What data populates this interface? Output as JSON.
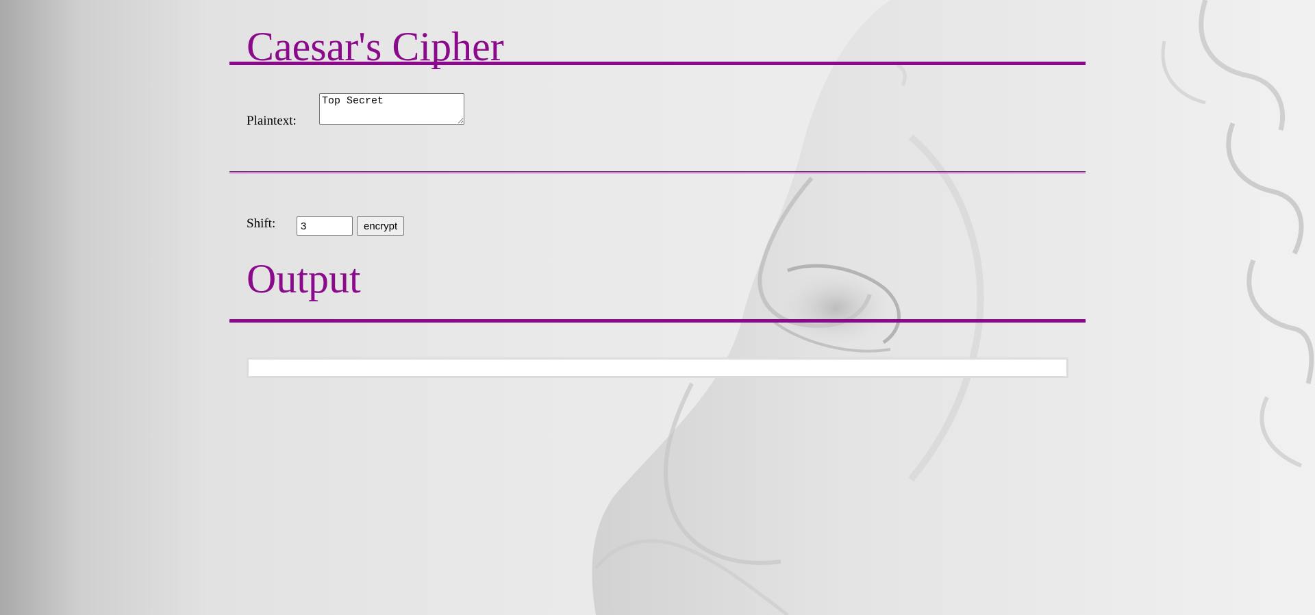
{
  "header": {
    "title": "Caesar's Cipher"
  },
  "plaintext": {
    "label": "Plaintext:",
    "value": "Top Secret"
  },
  "shift": {
    "label": "Shift:",
    "value": "3",
    "button_label": "encrypt"
  },
  "output": {
    "heading": "Output",
    "value": ""
  },
  "colors": {
    "accent": "#8b0a8b",
    "background": "#e9e9e9"
  },
  "background_image": "marble-statue-face"
}
